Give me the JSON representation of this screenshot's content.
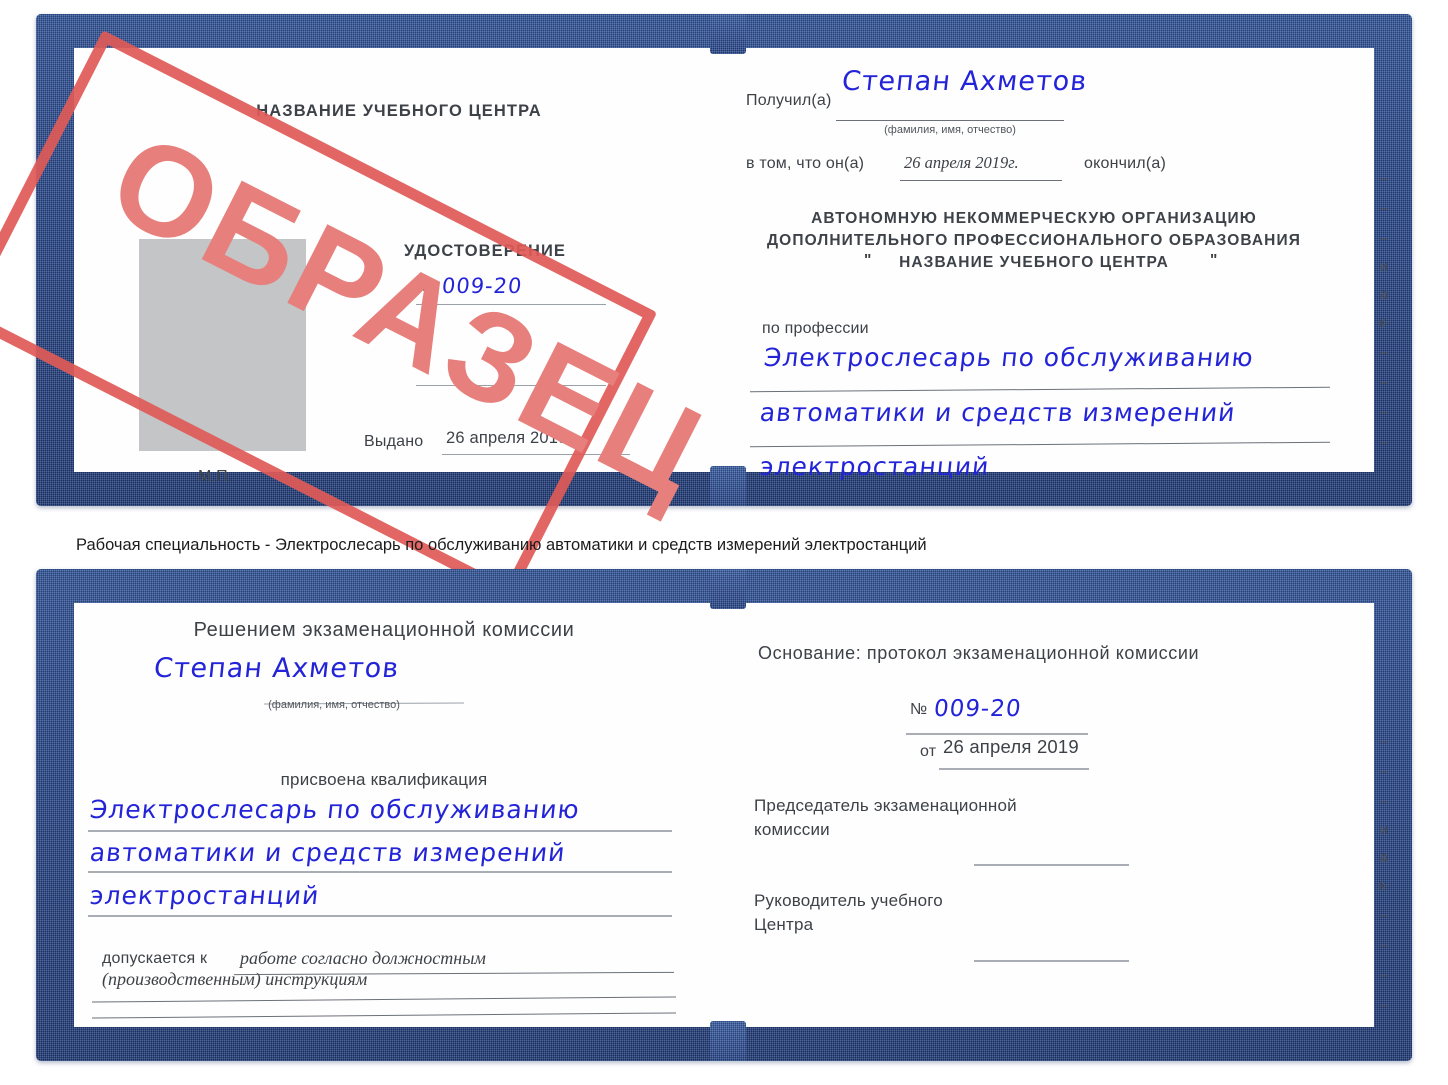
{
  "meta": {
    "document_type": "Удостоверение",
    "colors": {
      "cover_blue": "#27468a",
      "handwriting_blue": "#2323d8",
      "stamp_red": "#e05a57",
      "stamp_text_red": "#e7807c",
      "rule_gray": "#9aa0a8",
      "photo_gray": "#c3c5c7"
    }
  },
  "stamp": {
    "label": "ОБРАЗЕЦ"
  },
  "caption": {
    "text": "Рабочая специальность - Электрослесарь по обслуживанию автоматики и средств измерений электростанций"
  },
  "cert1": {
    "left": {
      "center_name_caps": "НАЗВАНИЕ УЧЕБНОГО ЦЕНТРА",
      "title_caps": "УДОСТОВЕРЕНИЕ",
      "number_label": "№",
      "number_value": "009-20",
      "issued_label": "Выдано",
      "issued_value": "26 апреля 2019",
      "seal_label": "М.П.",
      "photo_placeholder": "photo-placeholder"
    },
    "right": {
      "received_label": "Получил(а)",
      "received_value": "Степан Ахметов",
      "received_hint": "(фамилия, имя, отчество)",
      "in_that_label": "в том, что он(а)",
      "in_that_value": "26 апреля 2019г.",
      "graduated_label": "окончил(а)",
      "org_line1": "АВТОНОМНУЮ НЕКОММЕРЧЕСКУЮ ОРГАНИЗАЦИЮ",
      "org_line2": "ДОПОЛНИТЕЛЬНОГО ПРОФЕССИОНАЛЬНОГО ОБРАЗОВАНИЯ",
      "org_quote_open": "\"",
      "org_line3": "НАЗВАНИЕ УЧЕБНОГО ЦЕНТРА",
      "org_quote_close": "\"",
      "profession_label": "по профессии",
      "profession_line1": "Электрослесарь по обслуживанию",
      "profession_line2": "автоматики и средств измерений",
      "profession_line3": "электростанций"
    },
    "edge_fragments": [
      "–",
      "–",
      "–",
      "и",
      "а",
      "к-",
      "–",
      "–",
      "–",
      "–"
    ]
  },
  "cert2": {
    "left": {
      "heading": "Решением экзаменационной комиссии",
      "name_value": "Степан Ахметов",
      "name_hint": "(фамилия, имя, отчество)",
      "qualification_label": "присвоена квалификация",
      "qualification_line1": "Электрослесарь по обслуживанию",
      "qualification_line2": "автоматики и средств измерений",
      "qualification_line3": "электростанций",
      "admitted_label": "допускается к",
      "admitted_line1": "работе согласно должностным",
      "admitted_line2": "(производственным) инструкциям"
    },
    "right": {
      "basis_label": "Основание: протокол экзаменационной комиссии",
      "number_label": "№",
      "number_value": "009-20",
      "date_label": "от",
      "date_value": "26 апреля 2019",
      "chairman_line1": "Председатель экзаменационной",
      "chairman_line2": "комиссии",
      "head_line1": "Руководитель учебного",
      "head_line2": "Центра"
    },
    "edge_fragments": [
      "–",
      "–",
      "–",
      "и",
      "а",
      "к-",
      "–",
      "–",
      "–",
      "–"
    ]
  }
}
